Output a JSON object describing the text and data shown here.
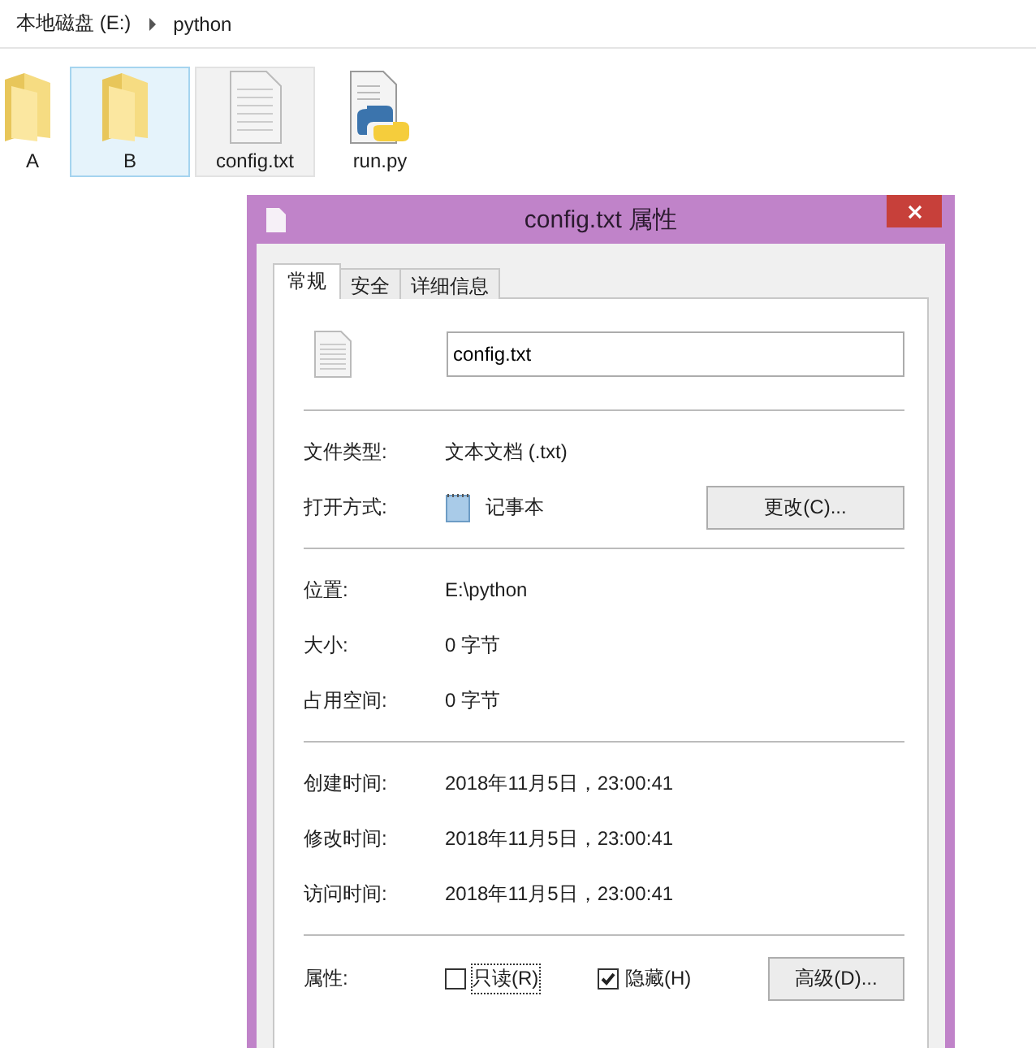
{
  "breadcrumb": [
    "本地磁盘 (E:)",
    "python"
  ],
  "files": [
    {
      "name": "A",
      "kind": "folder",
      "selected": false,
      "highlighted": false
    },
    {
      "name": "B",
      "kind": "folder",
      "selected": true,
      "highlighted": false
    },
    {
      "name": "config.txt",
      "kind": "text",
      "selected": false,
      "highlighted": true
    },
    {
      "name": "run.py",
      "kind": "python",
      "selected": false,
      "highlighted": false
    }
  ],
  "dialog": {
    "title": "config.txt 属性",
    "tabs": [
      {
        "label": "常规",
        "selected": true
      },
      {
        "label": "安全",
        "selected": false
      },
      {
        "label": "详细信息",
        "selected": false
      }
    ],
    "file_name": "config.txt",
    "sections": [
      [
        {
          "label": "文件类型:",
          "value": "文本文档 (.txt)",
          "kind": "text"
        },
        {
          "label": "打开方式:",
          "value": "记事本",
          "kind": "app",
          "button": "更改(C)..."
        }
      ],
      [
        {
          "label": "位置:",
          "value": "E:\\python",
          "kind": "text"
        },
        {
          "label": "大小:",
          "value": "0 字节",
          "kind": "text"
        },
        {
          "label": "占用空间:",
          "value": "0 字节",
          "kind": "text"
        }
      ],
      [
        {
          "label": "创建时间:",
          "value": "2018年11月5日，23:00:41",
          "kind": "text"
        },
        {
          "label": "修改时间:",
          "value": "2018年11月5日，23:00:41",
          "kind": "text"
        },
        {
          "label": "访问时间:",
          "value": "2018年11月5日，23:00:41",
          "kind": "text"
        }
      ]
    ],
    "attributes": {
      "label": "属性:",
      "checkboxes": [
        {
          "label": "只读(R)",
          "checked": false,
          "focused": true
        },
        {
          "label": "隐藏(H)",
          "checked": true,
          "focused": false
        }
      ],
      "button": "高级(D)..."
    }
  }
}
